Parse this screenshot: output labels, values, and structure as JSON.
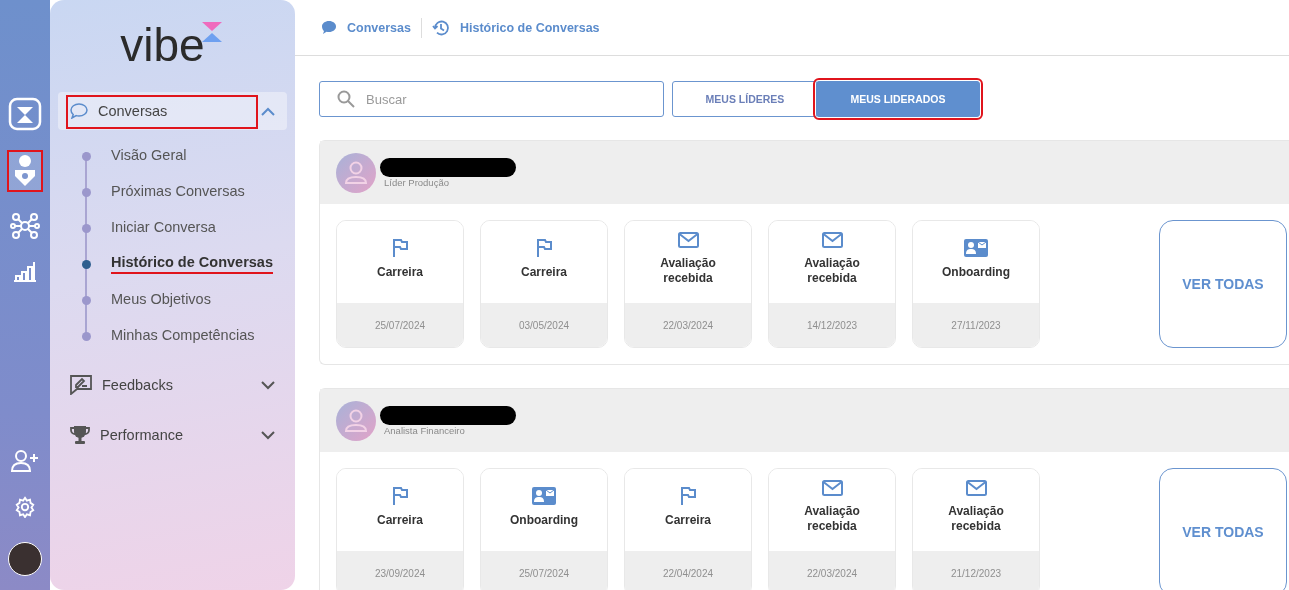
{
  "rail": {
    "top": [
      {
        "kind": "logo",
        "highlighted": false
      },
      {
        "kind": "ai-user",
        "highlighted": true
      },
      {
        "kind": "network",
        "highlighted": false
      },
      {
        "kind": "chart",
        "highlighted": false
      }
    ],
    "bottom": [
      {
        "kind": "add-user"
      },
      {
        "kind": "settings"
      },
      {
        "kind": "avatar"
      }
    ]
  },
  "sidebar": {
    "brand": "vibe",
    "nav": [
      {
        "label": "Conversas",
        "expanded": true,
        "highlighted": true,
        "children": [
          {
            "label": "Visão Geral",
            "selected": false,
            "underlined": false
          },
          {
            "label": "Próximas Conversas",
            "selected": false,
            "underlined": false
          },
          {
            "label": "Iniciar Conversa",
            "selected": false,
            "underlined": false
          },
          {
            "label": "Histórico de Conversas",
            "selected": true,
            "underlined": true
          },
          {
            "label": "Meus Objetivos",
            "selected": false,
            "underlined": false
          },
          {
            "label": "Minhas Competências",
            "selected": false,
            "underlined": false
          }
        ]
      },
      {
        "label": "Feedbacks",
        "expanded": false,
        "highlighted": false
      },
      {
        "label": "Performance",
        "expanded": false,
        "highlighted": false
      }
    ]
  },
  "breadcrumb": [
    {
      "label": "Conversas"
    },
    {
      "label": "Histórico de Conversas"
    }
  ],
  "search": {
    "placeholder": "Buscar"
  },
  "tabs": [
    {
      "label": "MEUS LÍDERES",
      "selected": false,
      "highlighted": false
    },
    {
      "label": "MEUS LIDERADOS",
      "selected": true,
      "highlighted": true
    }
  ],
  "people": [
    {
      "role": "Líder Produção",
      "more": "VER TODAS",
      "sessions": [
        {
          "kind": "flag",
          "title": "Carreira",
          "date": "25/07/2024"
        },
        {
          "kind": "flag",
          "title": "Carreira",
          "date": "03/05/2024"
        },
        {
          "kind": "mail",
          "title": "Avaliação recebida",
          "date": "22/03/2024"
        },
        {
          "kind": "mail",
          "title": "Avaliação recebida",
          "date": "14/12/2023"
        },
        {
          "kind": "card",
          "title": "Onboarding",
          "date": "27/11/2023"
        }
      ]
    },
    {
      "role": "Analista Financeiro",
      "more": "VER TODAS",
      "sessions": [
        {
          "kind": "flag",
          "title": "Carreira",
          "date": "23/09/2024"
        },
        {
          "kind": "card",
          "title": "Onboarding",
          "date": "25/07/2024"
        },
        {
          "kind": "flag",
          "title": "Carreira",
          "date": "22/04/2024"
        },
        {
          "kind": "mail",
          "title": "Avaliação recebida",
          "date": "22/03/2024"
        },
        {
          "kind": "mail",
          "title": "Avaliação recebida",
          "date": "21/12/2023"
        }
      ]
    }
  ]
}
